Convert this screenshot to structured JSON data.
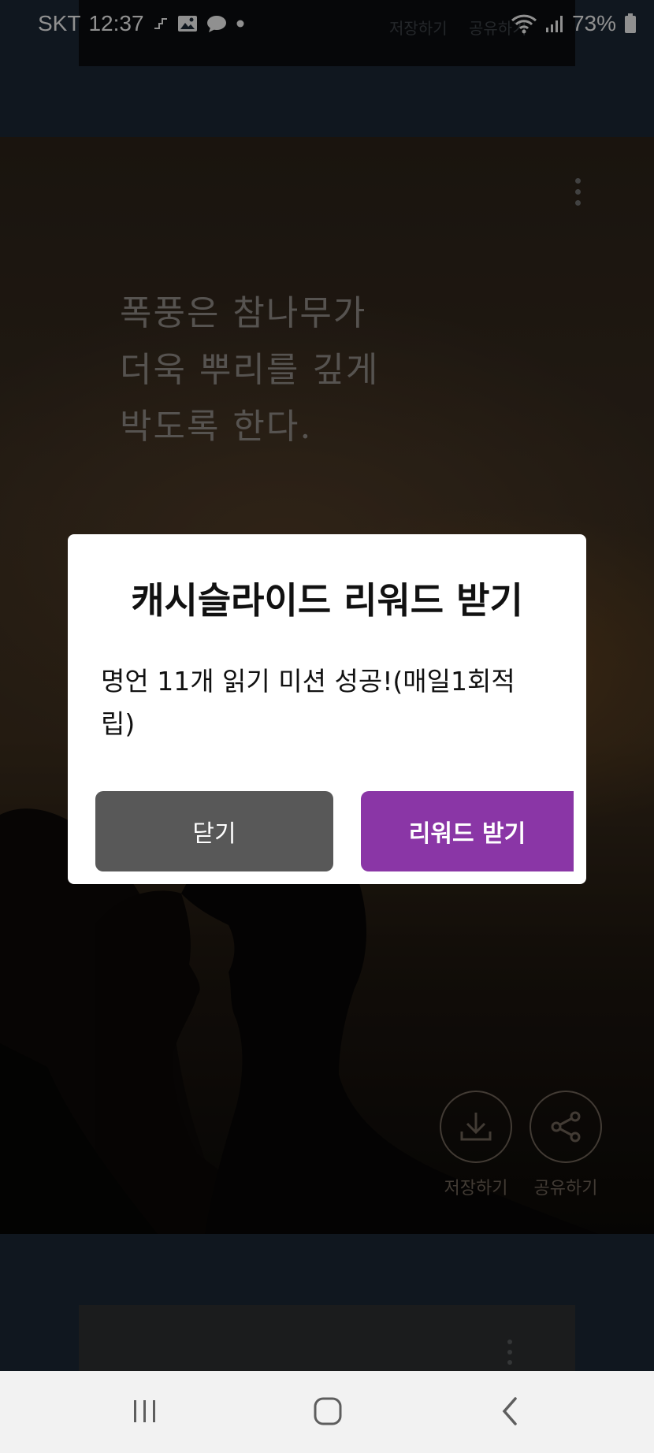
{
  "status_bar": {
    "carrier": "SKT",
    "time": "12:37",
    "battery": "73%"
  },
  "background_card": {
    "save_label": "저장하기",
    "share_label": "공유하기"
  },
  "main_card": {
    "quote_lines": [
      "폭풍은 참나무가",
      "더욱 뿌리를 깊게",
      "박도록 한다."
    ],
    "save_label": "저장하기",
    "share_label": "공유하기"
  },
  "dialog": {
    "title": "캐시슬라이드 리워드 받기",
    "message": "명언 11개 읽기 미션 성공!(매일1회적립)",
    "close_label": "닫기",
    "reward_label": "리워드 받기"
  },
  "colors": {
    "reward_button": "#8a36a6",
    "close_button": "#585858"
  }
}
